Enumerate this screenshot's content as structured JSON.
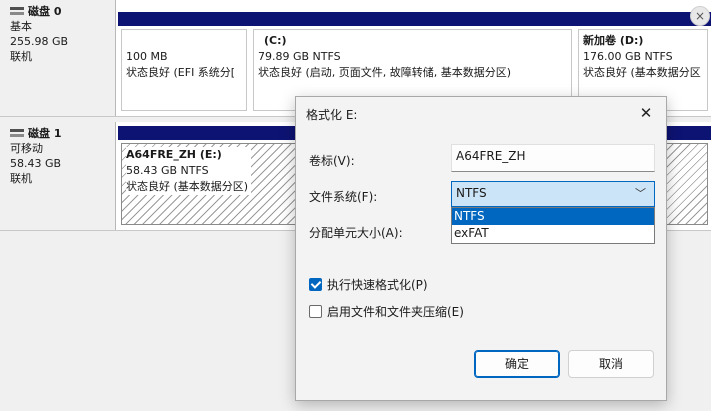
{
  "disks": [
    {
      "name": "磁盘 0",
      "type": "基本",
      "size": "255.98 GB",
      "state": "联机",
      "partitions": [
        {
          "title": "",
          "size": "100 MB",
          "status": "状态良好 (EFI 系统分[",
          "style": "normal"
        },
        {
          "title": "(C:)",
          "size": "79.89 GB NTFS",
          "status": "状态良好 (启动, 页面文件, 故障转储, 基本数据分区)",
          "style": "normal"
        },
        {
          "title": "新加卷  (D:)",
          "size": "176.00 GB NTFS",
          "status": "状态良好 (基本数据分区",
          "style": "normal"
        }
      ]
    },
    {
      "name": "磁盘 1",
      "type": "可移动",
      "size": "58.43 GB",
      "state": "联机",
      "partitions": [
        {
          "title": "A64FRE_ZH  (E:)",
          "size": "58.43 GB NTFS",
          "status": "状态良好 (基本数据分区)",
          "style": "hatched"
        }
      ]
    }
  ],
  "background_close_glyph": "×",
  "dialog": {
    "title": "格式化 E:",
    "close_glyph": "✕",
    "volume_label_label": "卷标(V):",
    "volume_label_value": "A64FRE_ZH",
    "filesystem_label": "文件系统(F):",
    "filesystem_value": "NTFS",
    "filesystem_options": [
      "NTFS",
      "exFAT"
    ],
    "allocation_label": "分配单元大小(A):",
    "quick_format_label": "执行快速格式化(P)",
    "quick_format_checked": true,
    "compression_label": "启用文件和文件夹压缩(E)",
    "compression_checked": false,
    "ok_label": "确定",
    "cancel_label": "取消"
  },
  "colors": {
    "partition_bar": "#0d1373",
    "accent": "#0067c0"
  }
}
